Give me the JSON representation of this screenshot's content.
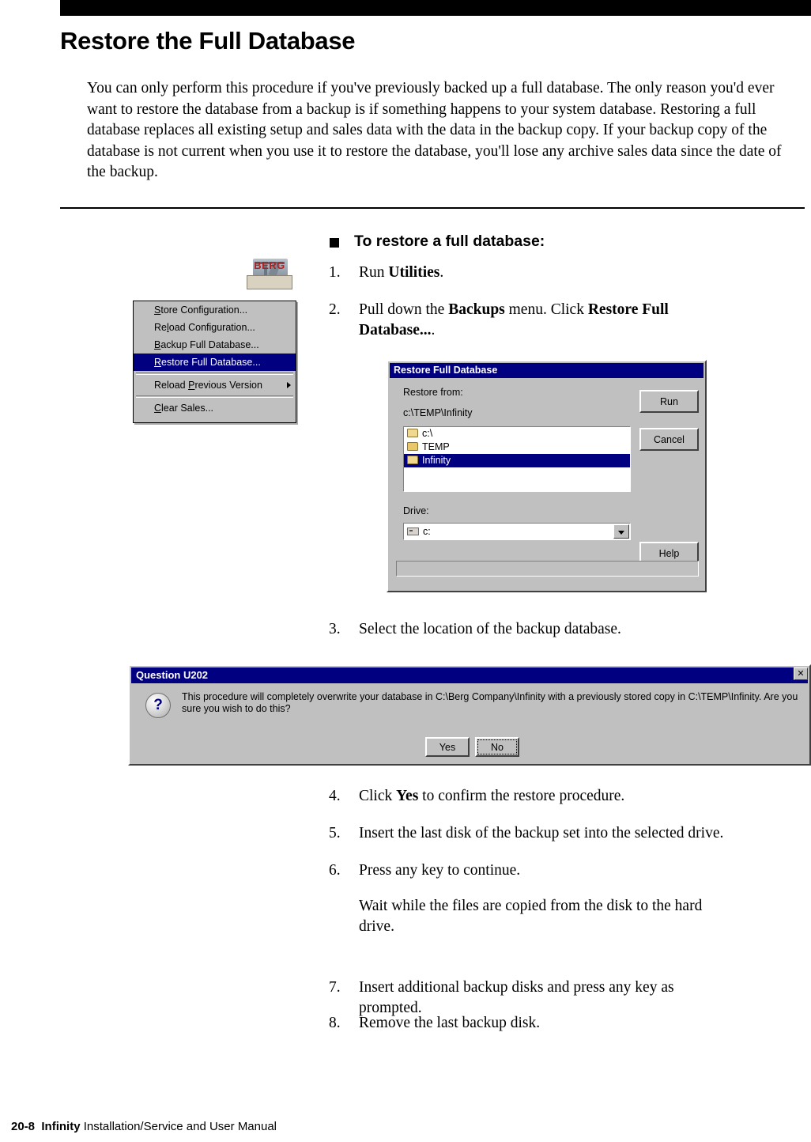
{
  "page": {
    "title": "Restore the Full Database",
    "intro": "You can only perform this procedure if you've previously backed up a full database. The only reason you'd ever want to restore the database from a backup is if something happens to your system database. Restoring a full database replaces all existing setup and sales data with the data in the backup copy. If your backup copy of the database is not current when you use it to restore the database, you'll lose any archive sales data since the date of the backup.",
    "footer_page": "20-8",
    "footer_title": "Infinity",
    "footer_rest": "Installation/Service and User Manual"
  },
  "procedure": {
    "heading": "To restore a full database:",
    "steps": [
      {
        "num": "1.",
        "html": "Run <b>Utilities</b>."
      },
      {
        "num": "2.",
        "html": "Pull down the <b>Backups</b> menu. Click <b>Restore Full Database...</b>."
      },
      {
        "num": "3.",
        "html": "Select the location of the backup database."
      },
      {
        "num": "4.",
        "html": "Click <b>Yes</b> to confirm the restore procedure."
      },
      {
        "num": "5.",
        "html": "Insert the last disk of the backup set into the selected drive."
      },
      {
        "num": "6.",
        "html": "Press any key to continue."
      },
      {
        "num": "",
        "html": "Wait while the files are copied from the disk to the hard drive."
      },
      {
        "num": "7.",
        "html": "Insert additional backup disks and press any key as prompted."
      },
      {
        "num": "8.",
        "html": "Remove the last backup disk."
      }
    ]
  },
  "berg_icon": {
    "label": "BERG"
  },
  "backups_menu": {
    "items": [
      {
        "label": "Store Configuration...",
        "selected": false,
        "submenu": false
      },
      {
        "label": "Reload Configuration...",
        "selected": false,
        "submenu": false
      },
      {
        "label": "Backup Full Database...",
        "selected": false,
        "submenu": false
      },
      {
        "label": "Restore Full Database...",
        "selected": true,
        "submenu": false
      },
      {
        "label": "Reload Previous Version",
        "selected": false,
        "submenu": true
      },
      {
        "label": "Clear Sales...",
        "selected": false,
        "submenu": false
      }
    ]
  },
  "restore_dialog": {
    "title": "Restore Full Database",
    "restore_from_label": "Restore from:",
    "path": "c:\\TEMP\\Infinity",
    "folders": [
      {
        "label": "c:\\",
        "selected": false
      },
      {
        "label": "TEMP",
        "selected": false
      },
      {
        "label": "Infinity",
        "selected": true
      }
    ],
    "drive_label": "Drive:",
    "drive_value": "c:",
    "buttons": {
      "run": "Run",
      "cancel": "Cancel",
      "help": "Help"
    }
  },
  "question_dialog": {
    "title": "Question U202",
    "close_glyph": "✕",
    "icon_glyph": "?",
    "message": "This procedure will completely overwrite your database in C:\\Berg Company\\Infinity with a previously stored copy in C:\\TEMP\\Infinity.  Are you sure you wish to do this?",
    "buttons": {
      "yes": "Yes",
      "no": "No"
    }
  }
}
